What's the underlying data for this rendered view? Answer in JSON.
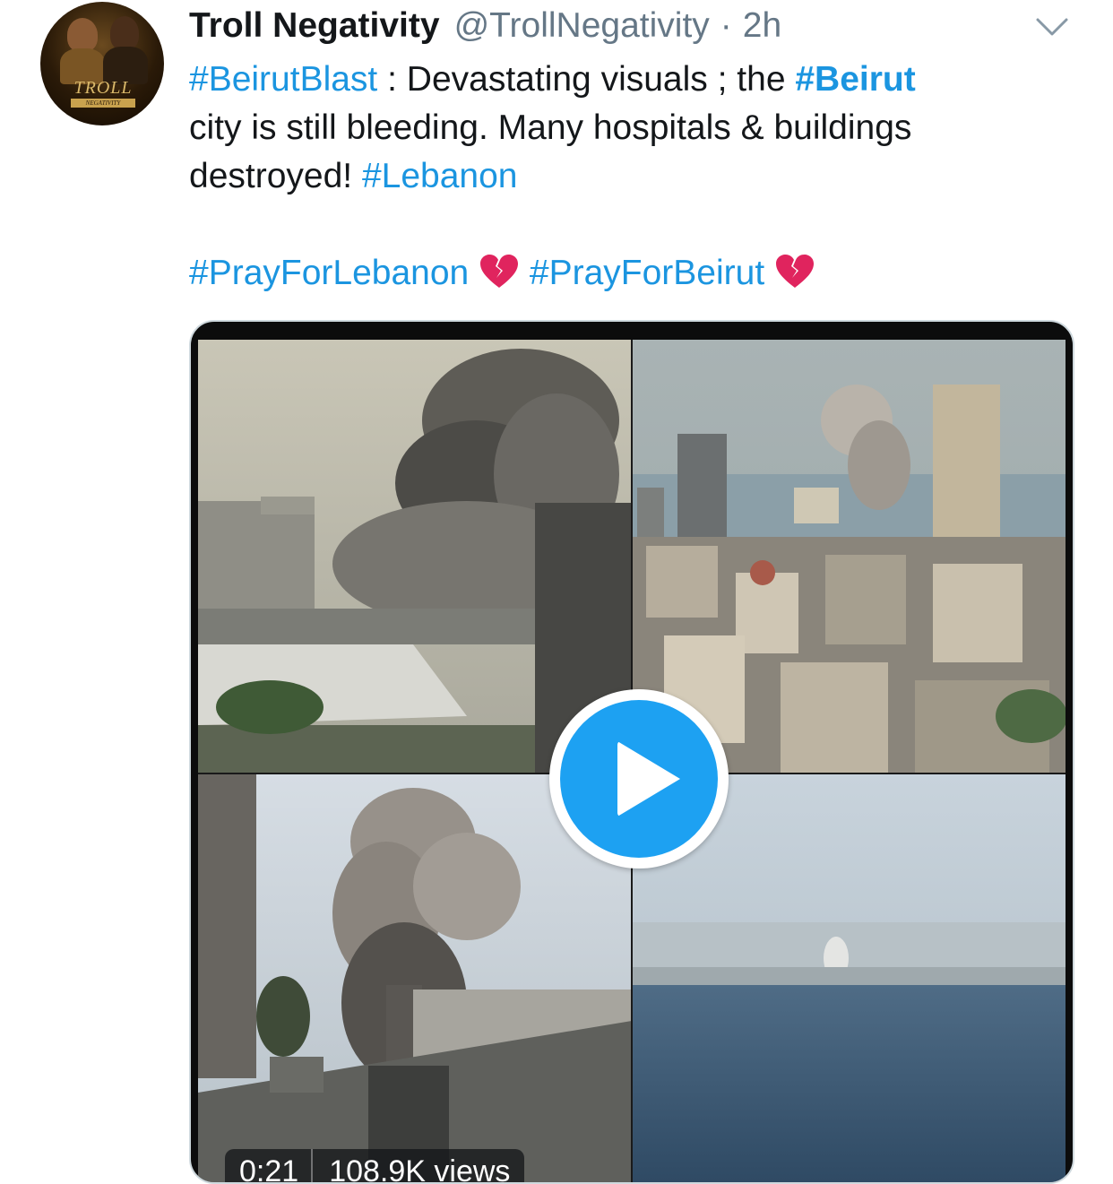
{
  "tweet": {
    "author": {
      "display_name": "Troll Negativity",
      "handle": "@TrollNegativity",
      "separator": "·",
      "timestamp": "2h",
      "avatar_text": "TROLL",
      "avatar_subtext": "NEGATIVITY"
    },
    "menu_icon": "chevron-down-icon",
    "text": {
      "line1": {
        "tag1": "#BeirutBlast",
        "t1": " : Devastating visuals ; the ",
        "tag2": "#Beirut"
      },
      "line2": "city is still bleeding. Many hospitals & buildings",
      "line3": {
        "t1": "destroyed! ",
        "tag1": "#Lebanon"
      },
      "line4": {
        "tag1": "#PrayForLebanon",
        "tag2": "#PrayForBeirut"
      },
      "emoji": "broken-heart-icon"
    },
    "media": {
      "type": "video",
      "duration": "0:21",
      "views": "108.9K views",
      "play_icon": "play-icon"
    }
  },
  "colors": {
    "hashtag": "#1b95e0",
    "text": "#14171a",
    "secondary": "#657786",
    "play_button": "#1da1f2",
    "heart": "#e0245e"
  }
}
